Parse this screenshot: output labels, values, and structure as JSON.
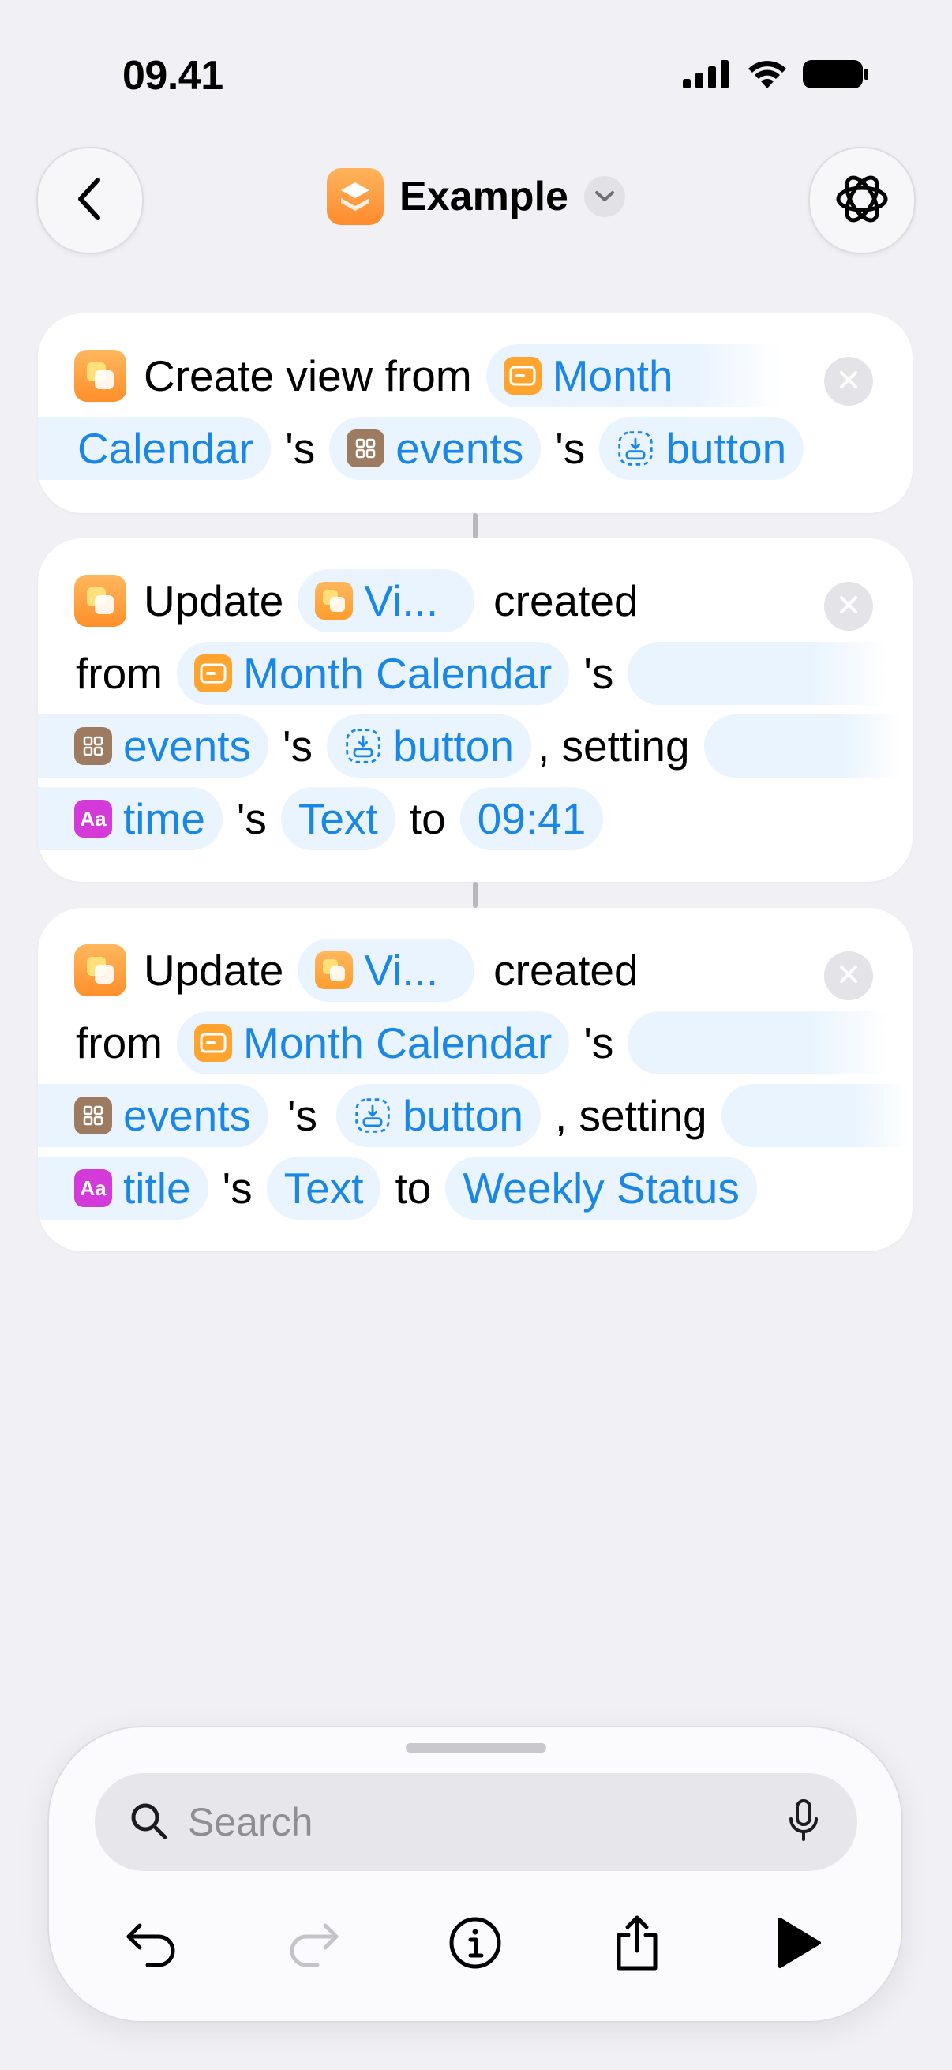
{
  "status_bar": {
    "time": "09.41"
  },
  "nav": {
    "title": "Example",
    "back_icon": "chevron-left-icon",
    "ai_icon": "apple-intelligence-icon"
  },
  "actions": [
    {
      "verb": "Create view from",
      "variable": "Month",
      "line2": {
        "var": "Calendar",
        "sep1": "'s",
        "events": "events",
        "sep2": "'s",
        "button": "button"
      }
    },
    {
      "verb": "Update",
      "view_var": "Vi...",
      "created": "created",
      "from": "from",
      "calendar": "Month Calendar",
      "sep0": "'s",
      "events": "events",
      "sep1": "'s",
      "button": "button",
      "setting": ", setting",
      "field": "time",
      "sep2": "'s",
      "prop": "Text",
      "to": "to",
      "value": "09:41"
    },
    {
      "verb": "Update",
      "view_var": "Vi...",
      "created": "created",
      "from": "from",
      "calendar": "Month Calendar",
      "sep0": "'s",
      "events": "events",
      "sep1": "'s",
      "button": "button",
      "setting": ", setting",
      "field": "title",
      "sep2": "'s",
      "prop": "Text",
      "to": "to",
      "value": "Weekly Status"
    }
  ],
  "search": {
    "placeholder": "Search"
  },
  "toolbar": [
    "undo-icon",
    "redo-icon",
    "info-icon",
    "share-icon",
    "play-icon"
  ],
  "colors": {
    "accent": "#1a87e6",
    "pill_bg": "#e9f4fe",
    "background": "#f0f0f5",
    "app_orange": "#ff9d2e"
  }
}
